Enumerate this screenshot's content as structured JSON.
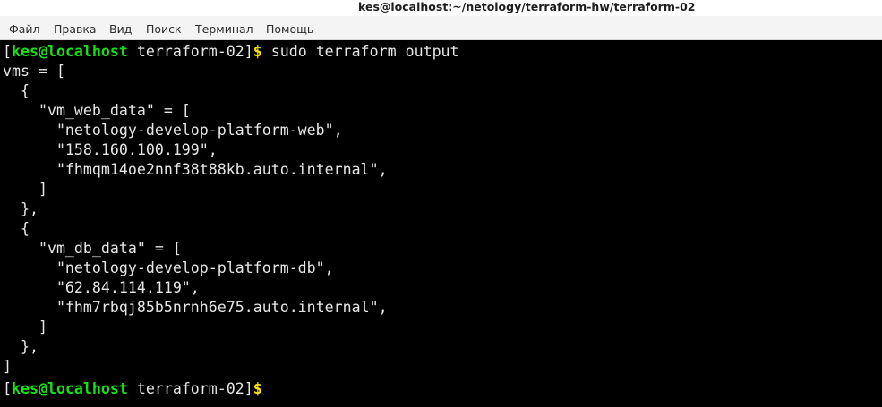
{
  "window": {
    "title": "kes@localhost:~/netology/terraform-hw/terraform-02"
  },
  "menubar": {
    "items": [
      "Файл",
      "Правка",
      "Вид",
      "Поиск",
      "Терминал",
      "Помощь"
    ]
  },
  "colors": {
    "terminal_bg": "#000000",
    "terminal_fg": "#e6e6e6",
    "prompt_userhost": "#16e016",
    "prompt_dollar": "#ffe600"
  },
  "terminal": {
    "prompt1": {
      "open_bracket": "[",
      "userhost": "kes@localhost",
      "dir": " terraform-02",
      "close_bracket": "]",
      "dollar": "$",
      "command": " sudo terraform output"
    },
    "output_lines": [
      "vms = [",
      "  {",
      "    \"vm_web_data\" = [",
      "      \"netology-develop-platform-web\",",
      "      \"158.160.100.199\",",
      "      \"fhmqm14oe2nnf38t88kb.auto.internal\",",
      "    ]",
      "  },",
      "  {",
      "    \"vm_db_data\" = [",
      "      \"netology-develop-platform-db\",",
      "      \"62.84.114.119\",",
      "      \"fhm7rbqj85b5nrnh6e75.auto.internal\",",
      "    ]",
      "  },",
      "]"
    ],
    "prompt2": {
      "open_bracket": "[",
      "userhost": "kes@localhost",
      "dir": " terraform-02",
      "close_bracket": "]",
      "dollar": "$"
    }
  }
}
